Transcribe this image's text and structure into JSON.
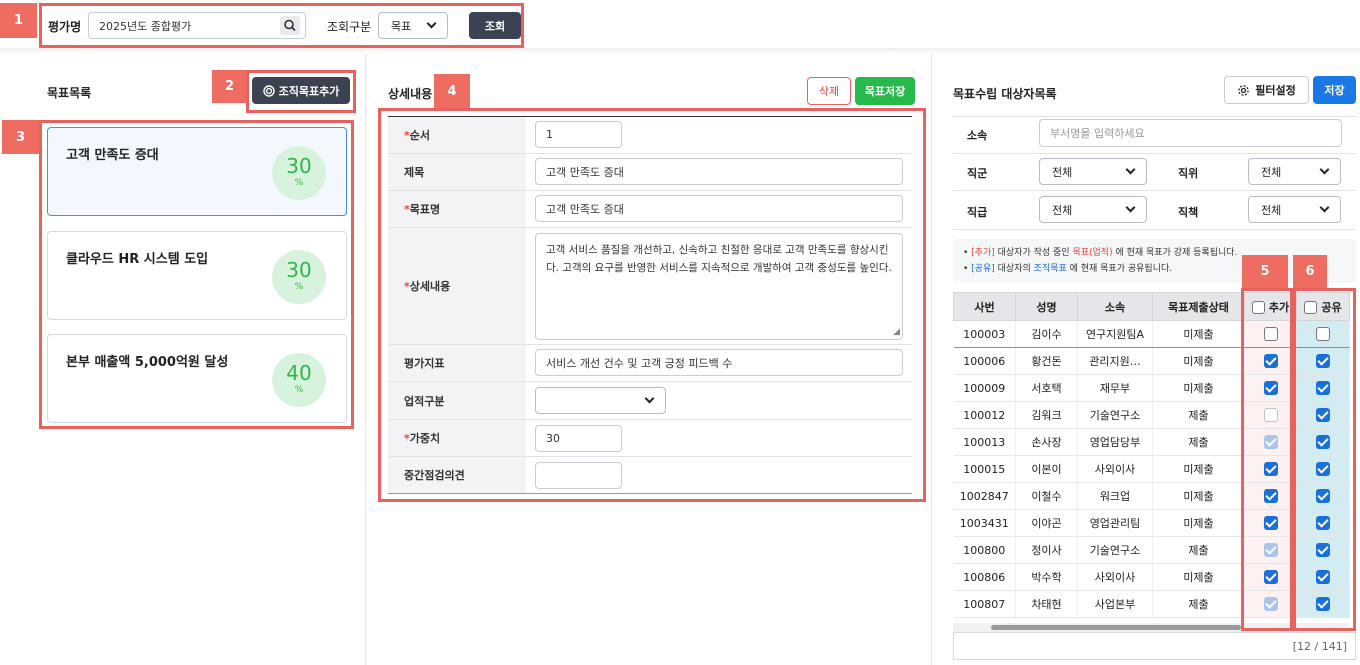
{
  "search": {
    "eval_label": "평가명",
    "eval_value": "2025년도 종합평가",
    "type_label": "조회구분",
    "type_value": "목표",
    "search_button": "조회"
  },
  "left": {
    "title": "목표목록",
    "add_button": "조직목표추가",
    "goals": [
      {
        "title": "고객 만족도 증대",
        "percent": "30",
        "unit": "%"
      },
      {
        "title": "클라우드 HR 시스템 도입",
        "percent": "30",
        "unit": "%"
      },
      {
        "title": "본부 매출액 5,000억원 달성",
        "percent": "40",
        "unit": "%"
      }
    ]
  },
  "detail": {
    "title": "상세내용",
    "delete_button": "삭제",
    "save_button": "목표저장",
    "required_mark": "*",
    "fields": {
      "order_label": "순서",
      "order_value": "1",
      "subject_label": "제목",
      "subject_value": "고객 만족도 증대",
      "goal_label": "목표명",
      "goal_value": "고객 만족도 증대",
      "desc_label": "상세내용",
      "desc_value": "고객 서비스 품질을 개선하고, 신속하고 친절한 응대로 고객 만족도를 향상시킨다. 고객의 요구를 반영한 서비스를 지속적으로 개발하여 고객 충성도를 높인다.",
      "kpi_label": "평가지표",
      "kpi_value": "서비스 개선 건수 및 고객 긍정 피드백 수",
      "perf_label": "업적구분",
      "perf_value": "",
      "weight_label": "가중치",
      "weight_value": "30",
      "mid_label": "중간점검의견",
      "mid_value": ""
    }
  },
  "right": {
    "title": "목표수립 대상자목록",
    "filter_button": "필터설정",
    "save_button": "저장",
    "filters": {
      "dept_label": "소속",
      "dept_placeholder": "부서명을 입력하세요",
      "group_label": "직군",
      "group_value": "전체",
      "position_label": "직위",
      "position_value": "전체",
      "grade_label": "직급",
      "grade_value": "전체",
      "duty_label": "직책",
      "duty_value": "전체"
    },
    "notes": {
      "n1_a": "[추가]",
      "n1_b": " 대상자가 작성 중인 ",
      "n1_c": "목표(업적)",
      "n1_d": " 에 현재 목표가 강제 등록됩니다.",
      "n2_a": "[공유]",
      "n2_b": " 대상자의 ",
      "n2_c": "조직목표",
      "n2_d": " 에 현재 목표가 공유됩니다."
    },
    "columns": [
      "사번",
      "성명",
      "소속",
      "목표제출상태",
      "추가",
      "공유"
    ],
    "rows": [
      {
        "id": "100003",
        "name": "김이수",
        "dept": "연구지원팀A",
        "status": "미제출",
        "add": "off",
        "share": "off"
      },
      {
        "id": "100006",
        "name": "황건돈",
        "dept": "관리지원…",
        "status": "미제출",
        "add": "on",
        "share": "on"
      },
      {
        "id": "100009",
        "name": "서호택",
        "dept": "재무부",
        "status": "미제출",
        "add": "on",
        "share": "on"
      },
      {
        "id": "100012",
        "name": "김워크",
        "dept": "기술연구소",
        "status": "제출",
        "add": "dis-off",
        "share": "on"
      },
      {
        "id": "100013",
        "name": "손사장",
        "dept": "영업담당부",
        "status": "제출",
        "add": "dis-on",
        "share": "on"
      },
      {
        "id": "100015",
        "name": "이본이",
        "dept": "사외이사",
        "status": "미제출",
        "add": "on",
        "share": "on"
      },
      {
        "id": "1002847",
        "name": "이철수",
        "dept": "워크업",
        "status": "미제출",
        "add": "on",
        "share": "on"
      },
      {
        "id": "1003431",
        "name": "이야곤",
        "dept": "영업관리팀",
        "status": "미제출",
        "add": "on",
        "share": "on"
      },
      {
        "id": "100800",
        "name": "정이사",
        "dept": "기술연구소",
        "status": "제출",
        "add": "dis-on",
        "share": "on"
      },
      {
        "id": "100806",
        "name": "박수학",
        "dept": "사외이사",
        "status": "미제출",
        "add": "on",
        "share": "on"
      },
      {
        "id": "100807",
        "name": "차태현",
        "dept": "사업본부",
        "status": "제출",
        "add": "dis-on",
        "share": "on"
      }
    ],
    "pager": "[12 / 141]"
  },
  "markers": [
    "1",
    "2",
    "3",
    "4",
    "5",
    "6"
  ]
}
